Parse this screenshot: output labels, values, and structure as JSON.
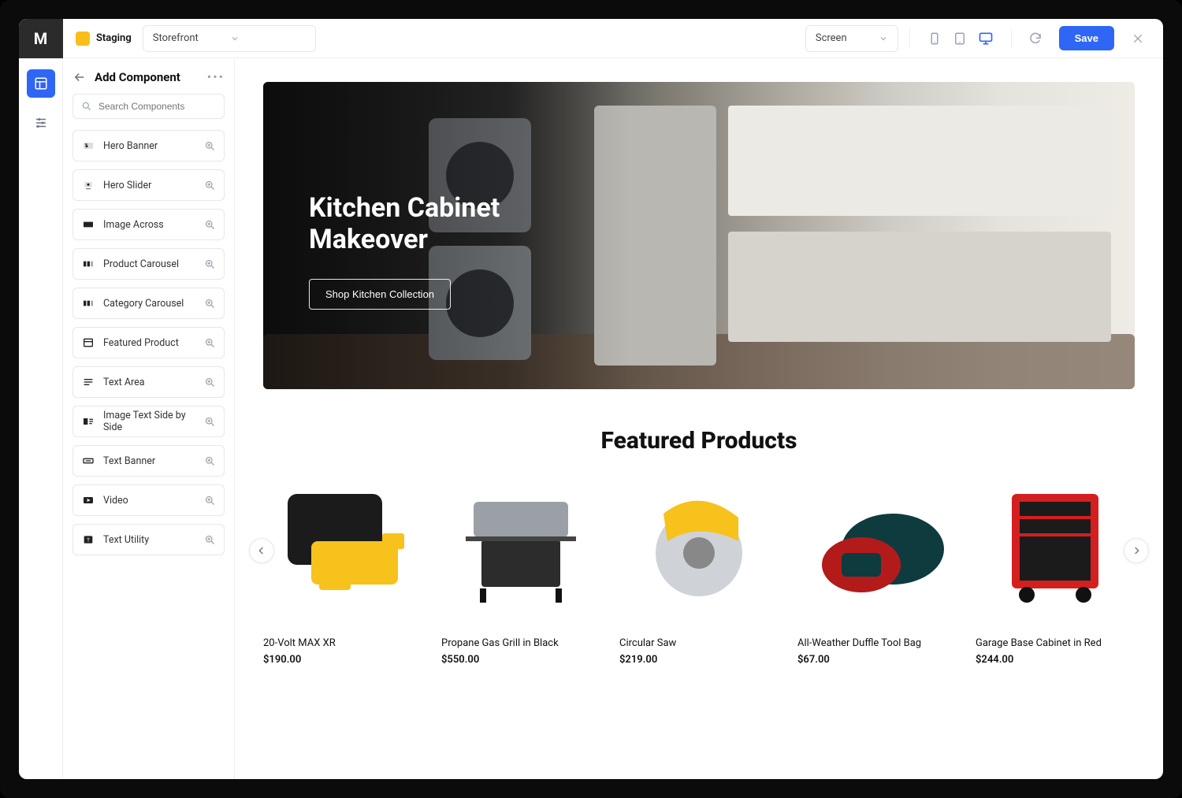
{
  "env": {
    "label": "Staging"
  },
  "topbar": {
    "context_select": "Storefront",
    "screen_select": "Screen",
    "save_label": "Save"
  },
  "panel": {
    "title": "Add Component",
    "search_placeholder": "Search Components",
    "components": [
      {
        "label": "Hero Banner",
        "icon": "hero-banner-icon"
      },
      {
        "label": "Hero Slider",
        "icon": "hero-slider-icon"
      },
      {
        "label": "Image Across",
        "icon": "image-across-icon"
      },
      {
        "label": "Product Carousel",
        "icon": "product-carousel-icon"
      },
      {
        "label": "Category Carousel",
        "icon": "category-carousel-icon"
      },
      {
        "label": "Featured Product",
        "icon": "featured-product-icon"
      },
      {
        "label": "Text Area",
        "icon": "text-area-icon"
      },
      {
        "label": "Image Text Side by Side",
        "icon": "image-text-icon"
      },
      {
        "label": "Text Banner",
        "icon": "text-banner-icon"
      },
      {
        "label": "Video",
        "icon": "video-icon"
      },
      {
        "label": "Text Utility",
        "icon": "text-utility-icon"
      }
    ]
  },
  "hero": {
    "title": "Kitchen Cabinet\nMakeover",
    "cta": "Shop Kitchen Collection"
  },
  "featured": {
    "heading": "Featured Products",
    "products": [
      {
        "name": "20-Volt MAX XR",
        "price": "$190.00",
        "swatch": [
          "#f6c21b",
          "#1b1b1b"
        ]
      },
      {
        "name": "Propane Gas Grill in Black",
        "price": "$550.00",
        "swatch": [
          "#9aa0a6",
          "#2c2c2c"
        ]
      },
      {
        "name": "Circular Saw",
        "price": "$219.00",
        "swatch": [
          "#f6c21b",
          "#cfd3d8"
        ]
      },
      {
        "name": "All-Weather Duffle Tool Bag",
        "price": "$67.00",
        "swatch": [
          "#0e3b3e",
          "#b31b1b"
        ]
      },
      {
        "name": "Garage Base Cabinet in Red",
        "price": "$244.00",
        "swatch": [
          "#d41f1f",
          "#1b1b1b"
        ]
      }
    ]
  }
}
